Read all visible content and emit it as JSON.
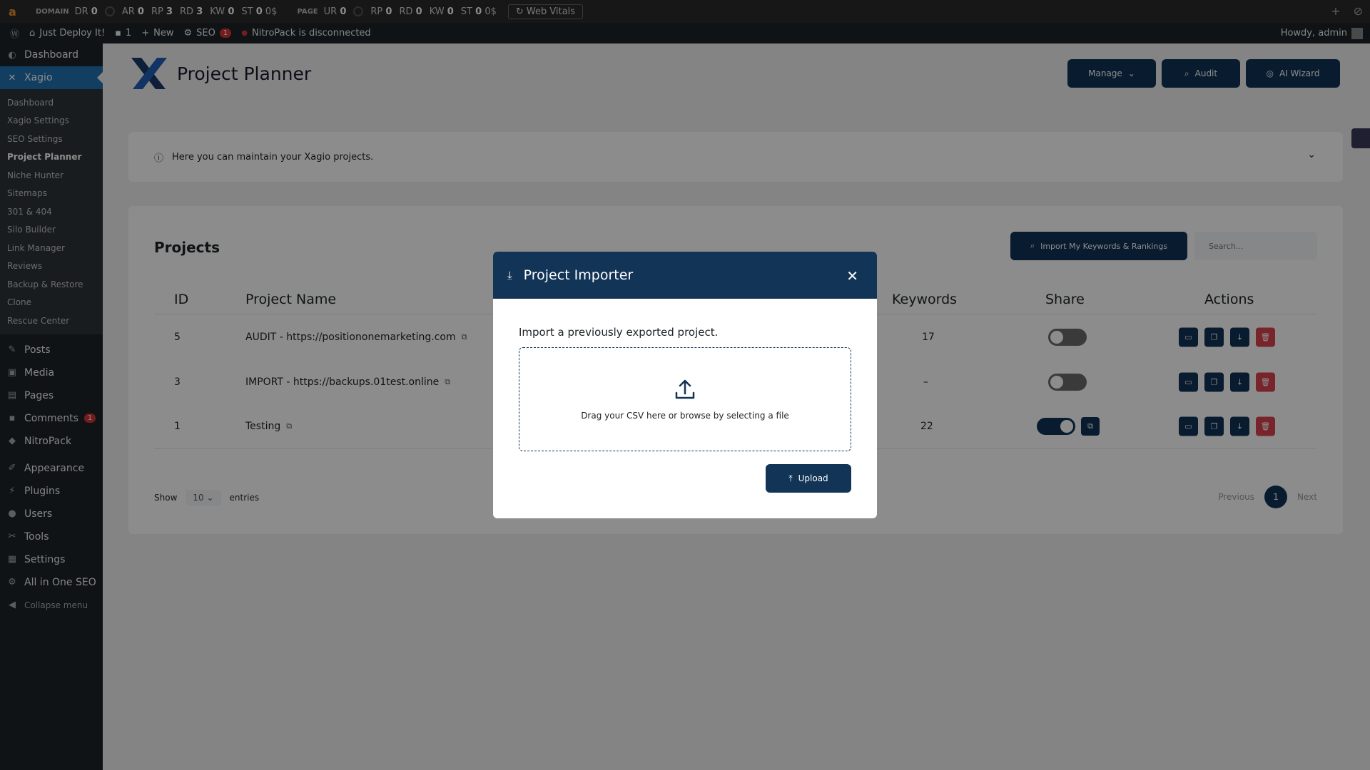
{
  "seo_toolbar": {
    "domain_label": "DOMAIN",
    "domain_metrics": [
      {
        "key": "DR",
        "value": "0"
      },
      {
        "key": "AR",
        "value": "0"
      },
      {
        "key": "RP",
        "value": "3"
      },
      {
        "key": "RD",
        "value": "3"
      },
      {
        "key": "KW",
        "value": "0"
      },
      {
        "key": "ST",
        "value": "0",
        "suffix": "0$"
      }
    ],
    "page_label": "PAGE",
    "page_metrics": [
      {
        "key": "UR",
        "value": "0"
      },
      {
        "key": "RP",
        "value": "0"
      },
      {
        "key": "RD",
        "value": "0"
      },
      {
        "key": "KW",
        "value": "0"
      },
      {
        "key": "ST",
        "value": "0",
        "suffix": "0$"
      }
    ],
    "web_vitals": "Web Vitals"
  },
  "admin_bar": {
    "site_name": "Just Deploy It!",
    "comments_count": "1",
    "new_label": "New",
    "seo_label": "SEO",
    "seo_badge": "1",
    "nitropack_status": "NitroPack is disconnected",
    "howdy": "Howdy, admin"
  },
  "sidebar": {
    "dashboard": "Dashboard",
    "xagio": "Xagio",
    "submenu": [
      "Dashboard",
      "Xagio Settings",
      "SEO Settings",
      "Project Planner",
      "Niche Hunter",
      "Sitemaps",
      "301 & 404",
      "Silo Builder",
      "Link Manager",
      "Reviews",
      "Backup & Restore",
      "Clone",
      "Rescue Center"
    ],
    "posts": "Posts",
    "media": "Media",
    "pages": "Pages",
    "comments": "Comments",
    "comments_badge": "1",
    "nitropack": "NitroPack",
    "appearance": "Appearance",
    "plugins": "Plugins",
    "users": "Users",
    "tools": "Tools",
    "settings": "Settings",
    "aioseo": "All in One SEO",
    "collapse": "Collapse menu"
  },
  "header": {
    "title": "Project Planner",
    "manage": "Manage",
    "audit": "Audit",
    "ai_wizard": "AI Wizard"
  },
  "info": {
    "text": "Here you can maintain your Xagio projects."
  },
  "projects": {
    "title": "Projects",
    "import_button": "Import My Keywords & Rankings",
    "search_placeholder": "Search...",
    "columns": {
      "id": "ID",
      "name": "Project Name",
      "keywords": "Keywords",
      "share": "Share",
      "actions": "Actions"
    },
    "rows": [
      {
        "id": "5",
        "name": "AUDIT - https://positiononemarketing.com",
        "keywords": "17",
        "shared": false
      },
      {
        "id": "3",
        "name": "IMPORT - https://backups.01test.online",
        "keywords": "–",
        "shared": false
      },
      {
        "id": "1",
        "name": "Testing",
        "keywords": "22",
        "shared": true
      }
    ],
    "show": "Show",
    "entries_value": "10",
    "entries": "entries",
    "previous": "Previous",
    "current_page": "1",
    "next": "Next"
  },
  "modal": {
    "title": "Project Importer",
    "description": "Import a previously exported project.",
    "dropzone_text": "Drag your CSV here or browse by selecting a file",
    "upload": "Upload"
  },
  "colors": {
    "primary": "#123456",
    "danger": "#d9434e",
    "wp_dark": "#1d2327",
    "wp_blue": "#2271b1"
  }
}
